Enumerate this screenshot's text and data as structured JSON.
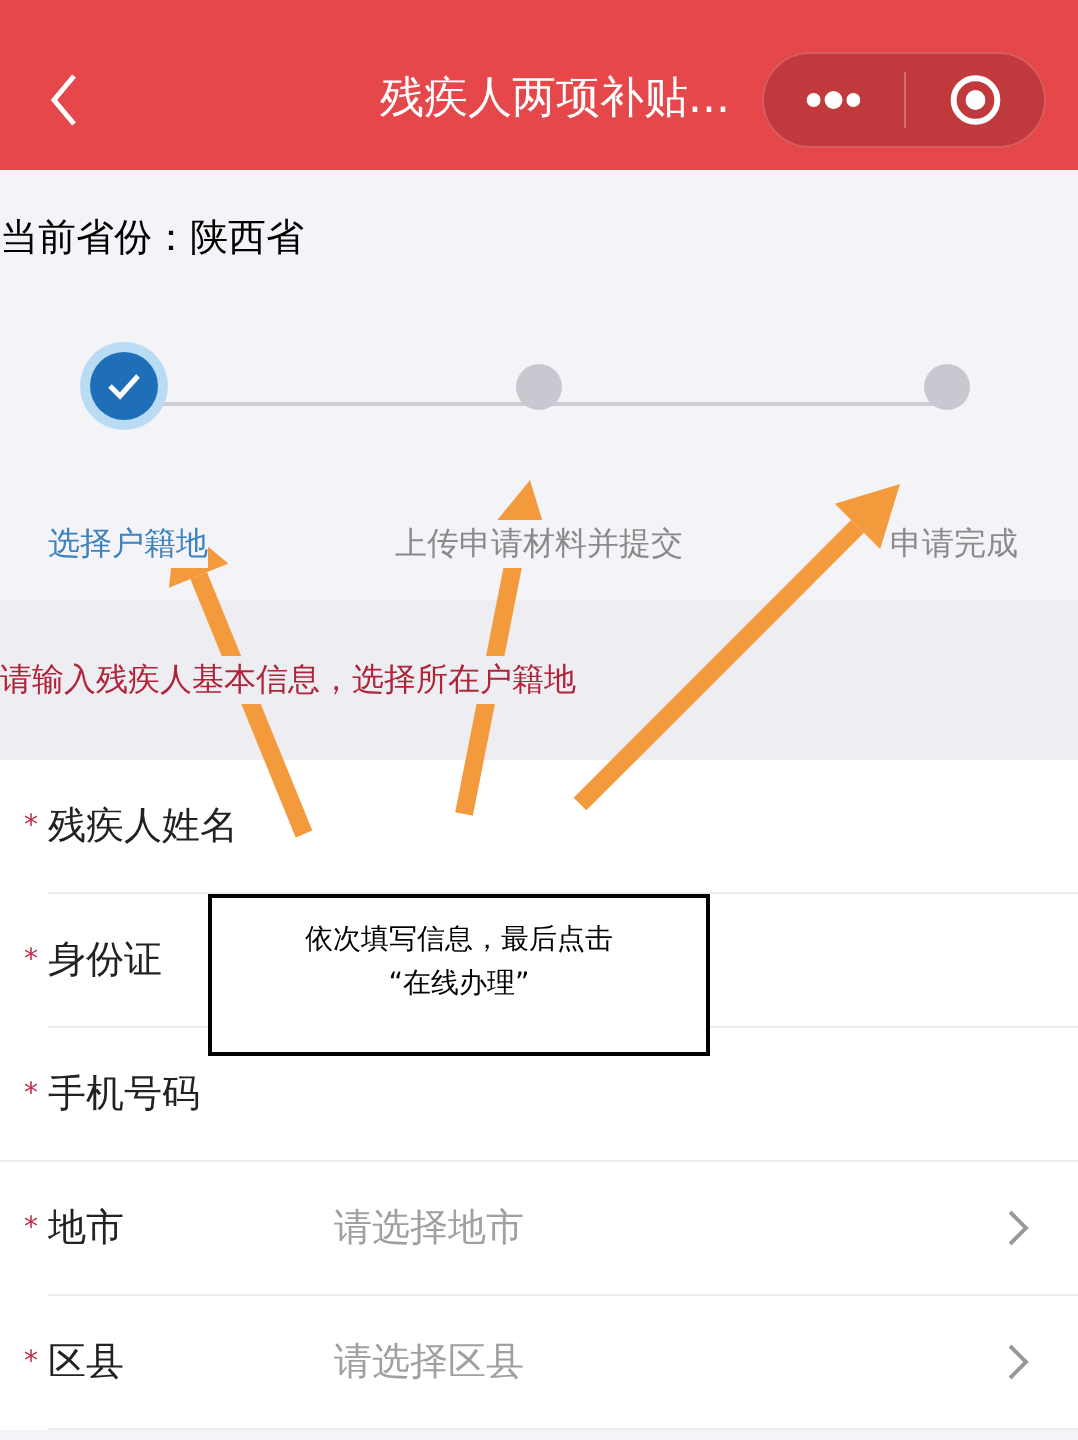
{
  "nav": {
    "title": "残疾人两项补贴..."
  },
  "province": {
    "text": "当前省份：陕西省"
  },
  "steps": [
    {
      "label": "选择户籍地",
      "selected": true
    },
    {
      "label": "上传申请材料并提交",
      "selected": false
    },
    {
      "label": "申请完成",
      "selected": false
    }
  ],
  "hint": "请输入残疾人基本信息，选择所在户籍地",
  "required_mark": "*",
  "fields": [
    {
      "kind": "text",
      "label": "残疾人姓名",
      "required": true
    },
    {
      "kind": "text",
      "label": "身份证",
      "required": true
    },
    {
      "kind": "text",
      "label": "手机号码",
      "required": true
    },
    {
      "kind": "select",
      "label": "地市",
      "required": true,
      "placeholder": "请选择地市"
    },
    {
      "kind": "select",
      "label": "区县",
      "required": true,
      "placeholder": "请选择区县"
    }
  ],
  "annotation": {
    "text": "依次填写信息，最后点击\n“在线办理”"
  }
}
